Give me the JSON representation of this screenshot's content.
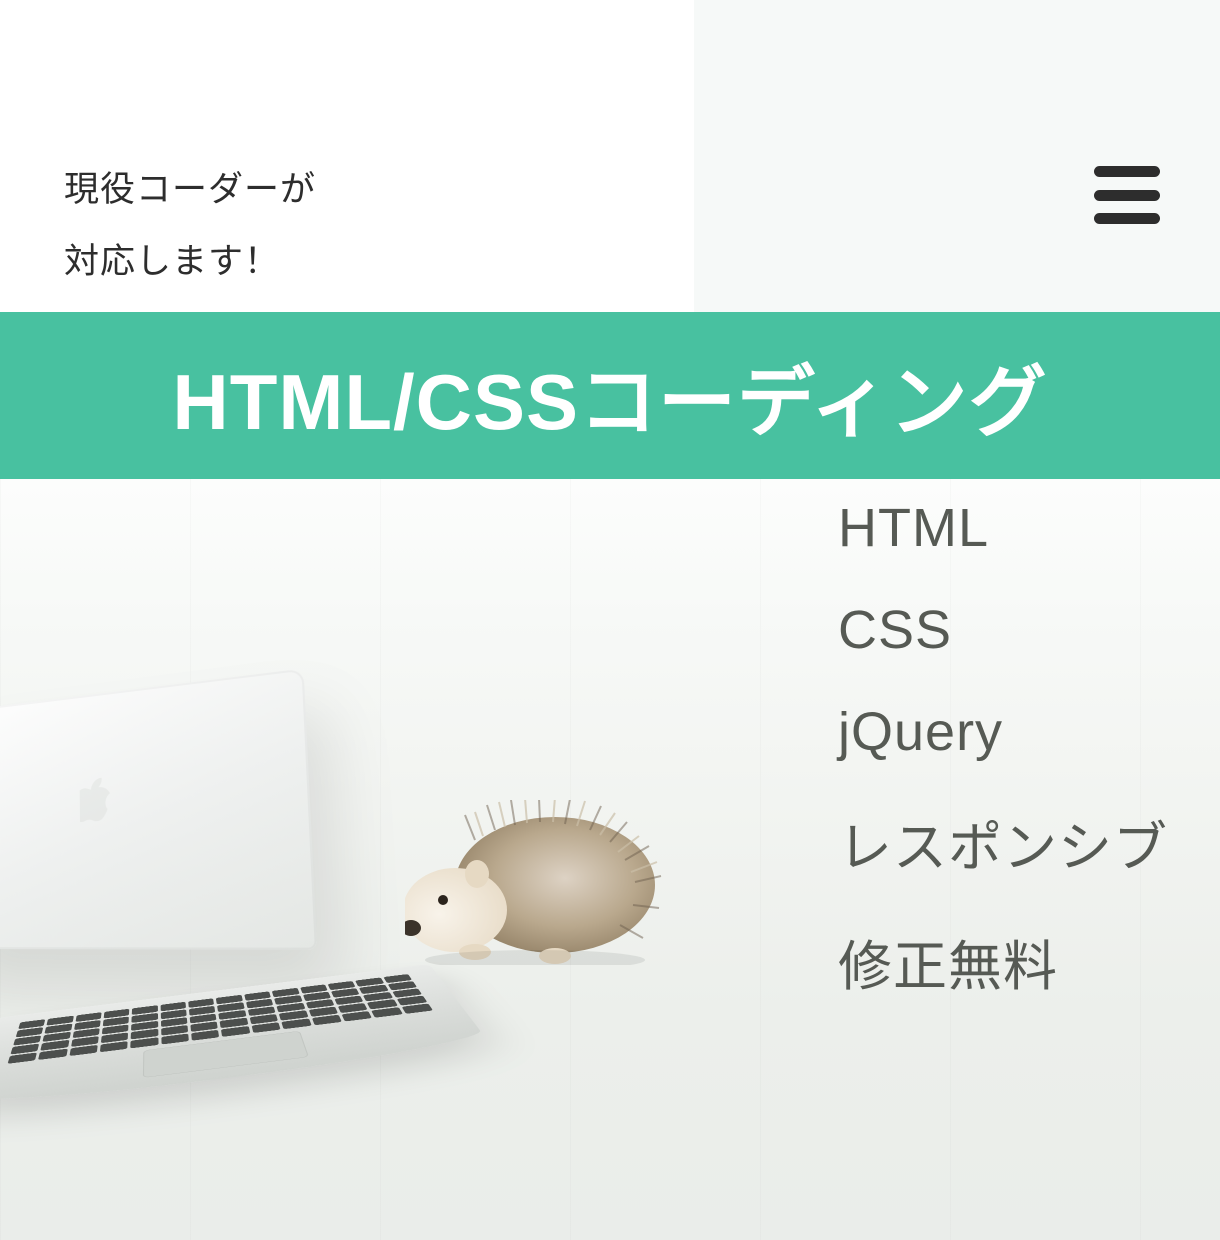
{
  "header": {
    "sublead": "現役コーダーが\n対応します！",
    "menu_icon": "hamburger-icon"
  },
  "band": {
    "title": "HTML/CSSコーディング"
  },
  "colors": {
    "accent_teal": "#48c1a0",
    "underline_orange": "#f29a3a",
    "text_dark": "#2d2d2d",
    "text_muted": "#565a54"
  },
  "skills": [
    {
      "label": "HTML"
    },
    {
      "label": "CSS"
    },
    {
      "label": "jQuery"
    },
    {
      "label": "レスポンシブ"
    },
    {
      "label": "修正無料"
    }
  ]
}
